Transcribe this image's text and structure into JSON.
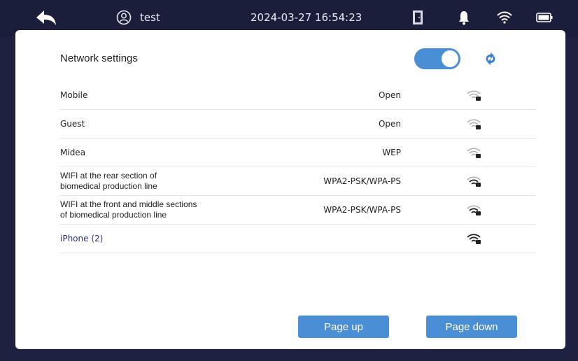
{
  "topbar": {
    "user": "test",
    "datetime": "2024-03-27 16:54:23",
    "icons": [
      "back-icon",
      "user-icon",
      "door-icon",
      "bell-icon",
      "wifi-icon",
      "battery-icon"
    ]
  },
  "panel": {
    "title": "Network settings",
    "toggle_on": true,
    "accent": "#4a8fd6"
  },
  "networks": [
    {
      "name": "Mobile",
      "security": "Open",
      "signal": "weak-locked"
    },
    {
      "name": "Guest",
      "security": "Open",
      "signal": "weak-locked"
    },
    {
      "name": "Midea",
      "security": "WEP",
      "signal": "weak-locked"
    },
    {
      "name_lines": [
        "WIFI at the rear section of",
        "biomedical production line"
      ],
      "security": "WPA2-PSK/WPA-PS",
      "signal": "strong-locked"
    },
    {
      "name_lines": [
        "WIFI at the front and middle sections",
        "of biomedical production line"
      ],
      "security": "WPA2-PSK/WPA-PS",
      "signal": "strong-locked"
    },
    {
      "name": "iPhone (2)",
      "security": "",
      "signal": "full-locked"
    }
  ],
  "buttons": {
    "page_up": "Page up",
    "page_down": "Page down"
  }
}
